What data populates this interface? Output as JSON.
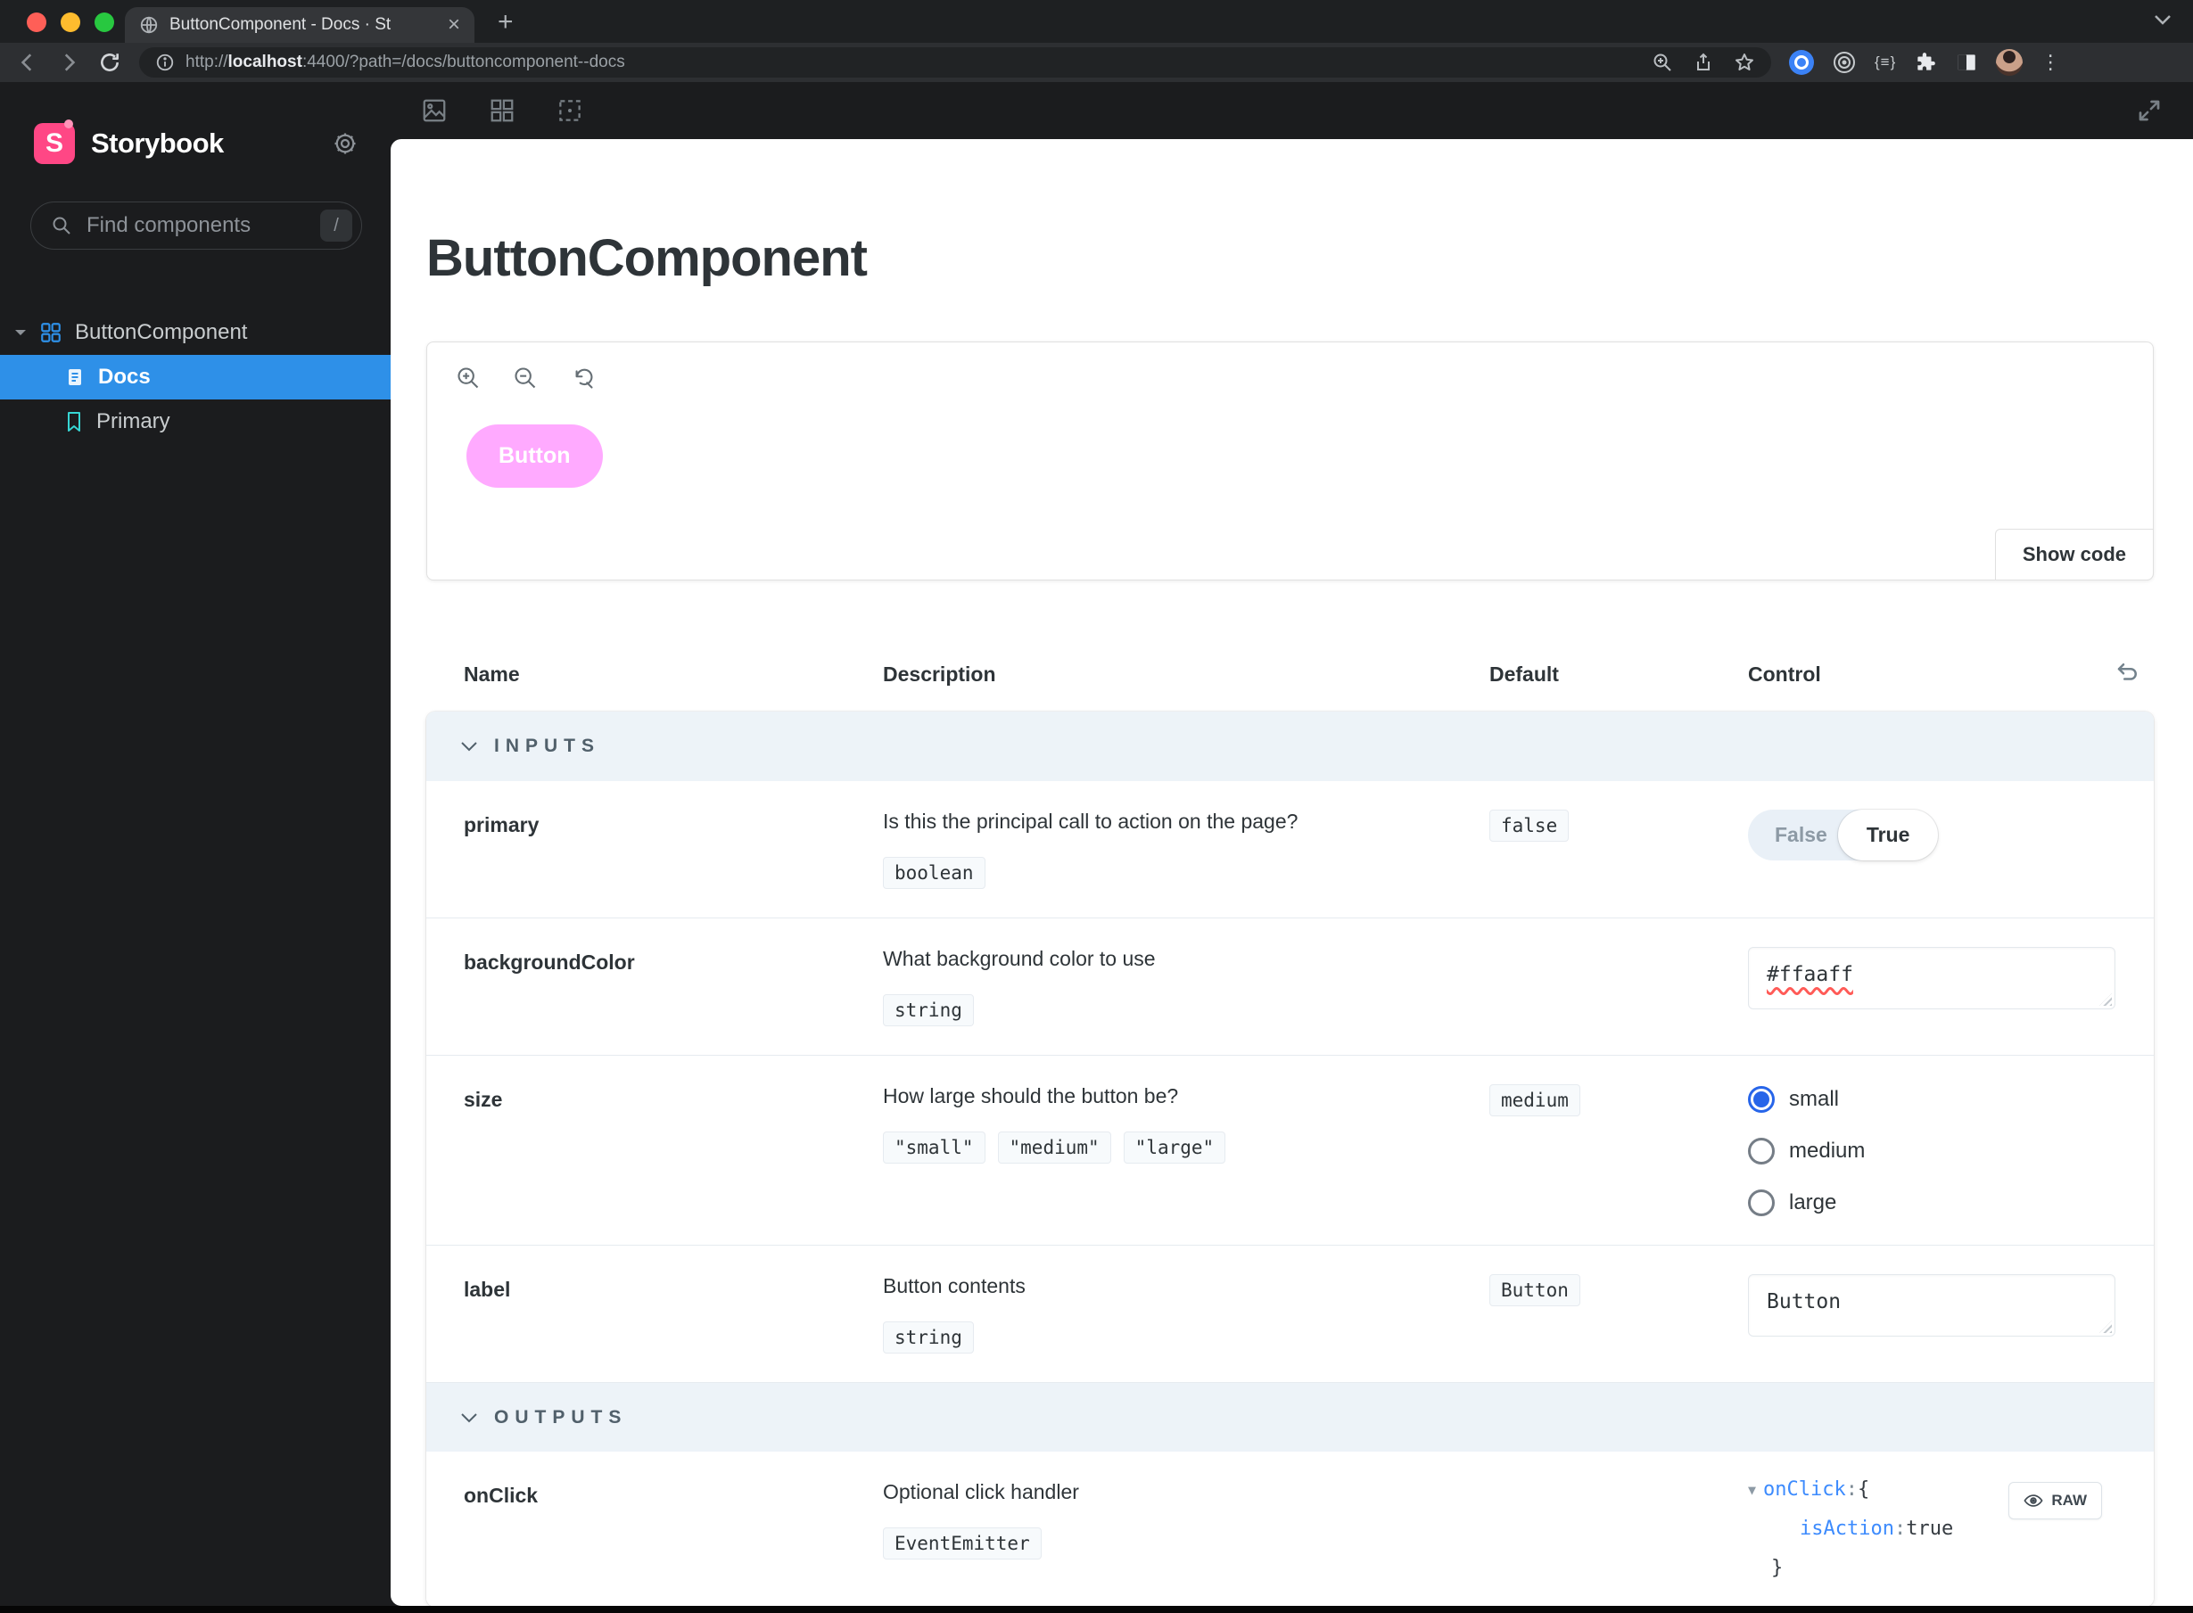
{
  "colors": {
    "accent_pink": "#ff4785",
    "selection_blue": "#2e90e8",
    "button_pink": "#ffaaff",
    "bookmark_teal": "#37d5d3"
  },
  "browser": {
    "tab_title": "ButtonComponent - Docs · St",
    "close_glyph": "×",
    "new_tab_glyph": "+",
    "menu_glyph": "⋮",
    "devtools_glyph": "{≡}",
    "url_prefix": "http://",
    "url_host": "localhost",
    "url_rest": ":4400/?path=/docs/buttoncomponent--docs"
  },
  "sidebar": {
    "logo_letter": "S",
    "title": "Storybook",
    "search": {
      "placeholder": "Find components",
      "shortcut": "/"
    },
    "tree": {
      "root_label": "ButtonComponent",
      "docs_label": "Docs",
      "story_label": "Primary"
    }
  },
  "docs": {
    "title": "ButtonComponent",
    "preview_button_label": "Button",
    "show_code_label": "Show code"
  },
  "args_table": {
    "columns": {
      "name": "Name",
      "description": "Description",
      "default": "Default",
      "control": "Control"
    },
    "sections": {
      "inputs": "INPUTS",
      "outputs": "OUTPUTS"
    },
    "rows": {
      "primary": {
        "name": "primary",
        "description": "Is this the principal call to action on the page?",
        "type": "boolean",
        "default": "false",
        "toggle_off": "False",
        "toggle_on": "True"
      },
      "background_color": {
        "name": "backgroundColor",
        "description": "What background color to use",
        "type": "string",
        "value": "#ffaaff"
      },
      "size": {
        "name": "size",
        "description": "How large should the button be?",
        "type_options": [
          "\"small\"",
          "\"medium\"",
          "\"large\""
        ],
        "default": "medium",
        "options": [
          "small",
          "medium",
          "large"
        ],
        "selected": "small"
      },
      "label": {
        "name": "label",
        "description": "Button contents",
        "type": "string",
        "default": "Button",
        "value": "Button"
      },
      "on_click": {
        "name": "onClick",
        "description": "Optional click handler",
        "type": "EventEmitter",
        "tree_key": "onClick",
        "tree_sep": " : ",
        "tree_open": "{",
        "tree_nested_key": "isAction",
        "tree_nested_sep": " :  ",
        "tree_nested_value": "true",
        "tree_close": "}",
        "raw_label": "RAW"
      }
    }
  }
}
